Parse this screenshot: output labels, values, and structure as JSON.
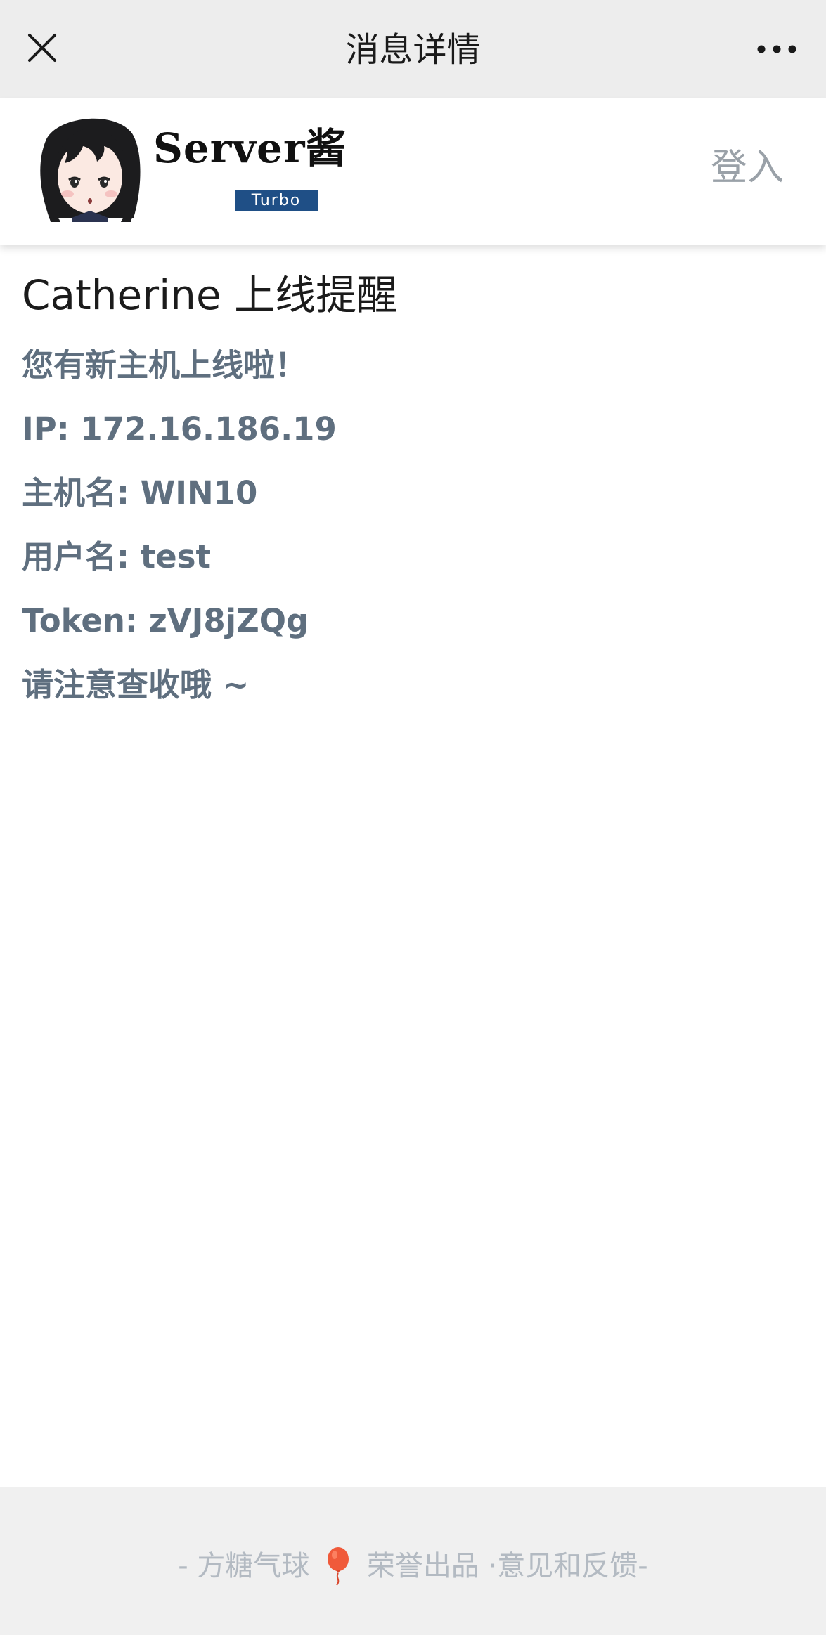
{
  "topbar": {
    "title": "消息详情",
    "close_icon": "close-icon",
    "more_icon": "more-dots-icon"
  },
  "header": {
    "brand_name": "Server酱",
    "badge": "Turbo",
    "login_label": "登入",
    "badge_color": "#1f4f86"
  },
  "message": {
    "title": "Catherine 上线提醒",
    "lines": [
      "您有新主机上线啦！",
      "IP: 172.16.186.19",
      "主机名: WIN10",
      "用户名: test",
      "Token: zVJ8jZQg",
      "请注意查收哦 ~"
    ],
    "text_color": "#5f6f7f"
  },
  "footer": {
    "prefix": "- 方糖气球",
    "honor": "荣誉出品",
    "feedback": "·意见和反馈",
    "suffix": "-",
    "balloon_icon": "balloon-icon"
  }
}
